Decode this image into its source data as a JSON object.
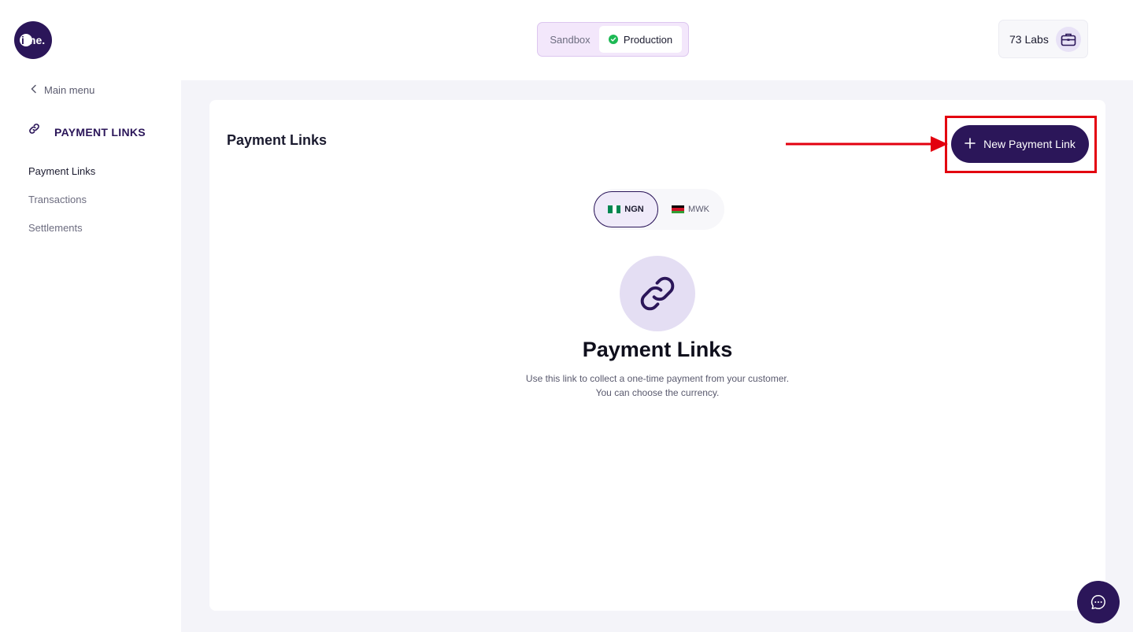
{
  "logo": {
    "text": "me."
  },
  "environment": {
    "options": [
      "Sandbox",
      "Production"
    ],
    "selected": "Production"
  },
  "account": {
    "name": "73 Labs",
    "icon": "briefcase-icon"
  },
  "sidebar": {
    "back_label": "Main menu",
    "section_title": "PAYMENT LINKS",
    "section_icon": "link-icon",
    "items": [
      {
        "label": "Payment Links",
        "active": true
      },
      {
        "label": "Transactions",
        "active": false
      },
      {
        "label": "Settlements",
        "active": false
      }
    ]
  },
  "main": {
    "title": "Payment Links",
    "new_button_label": "New Payment Link",
    "currencies": [
      {
        "code": "NGN",
        "selected": true
      },
      {
        "code": "MWK",
        "selected": false
      }
    ],
    "empty_state": {
      "icon": "link-icon",
      "title": "Payment Links",
      "description_line1": "Use this link to collect a one-time payment from your customer.",
      "description_line2": "You can choose the currency."
    }
  },
  "colors": {
    "brand": "#2b1659",
    "annotation": "#e3000f",
    "success": "#1db954"
  }
}
